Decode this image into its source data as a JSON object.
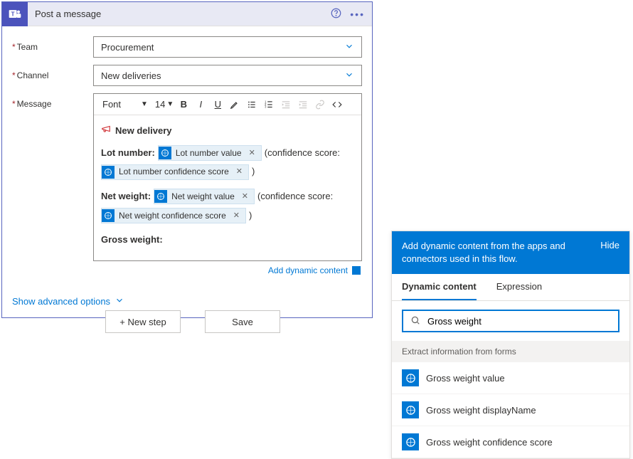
{
  "card": {
    "title": "Post a message",
    "fields": {
      "team": {
        "label": "Team",
        "value": "Procurement"
      },
      "channel": {
        "label": "Channel",
        "value": "New deliveries"
      },
      "message": {
        "label": "Message"
      }
    },
    "toolbar": {
      "font": "Font",
      "size": "14"
    },
    "editor": {
      "heading": "New delivery",
      "lot_label": "Lot number:",
      "conf_open": "(confidence score:",
      "conf_close": ")",
      "net_label": "Net weight:",
      "gross_label": "Gross weight:",
      "tokens": {
        "lot_value": "Lot number value",
        "lot_conf": "Lot number confidence score",
        "net_value": "Net weight value",
        "net_conf": "Net weight confidence score"
      }
    },
    "add_dynamic": "Add dynamic content",
    "advanced": "Show advanced options"
  },
  "actions": {
    "new_step": "+ New step",
    "save": "Save"
  },
  "panel": {
    "heading": "Add dynamic content from the apps and connectors used in this flow.",
    "hide": "Hide",
    "tabs": {
      "dynamic": "Dynamic content",
      "expression": "Expression"
    },
    "search_value": "Gross weight",
    "group": "Extract information from forms",
    "results": [
      "Gross weight value",
      "Gross weight displayName",
      "Gross weight confidence score"
    ]
  }
}
